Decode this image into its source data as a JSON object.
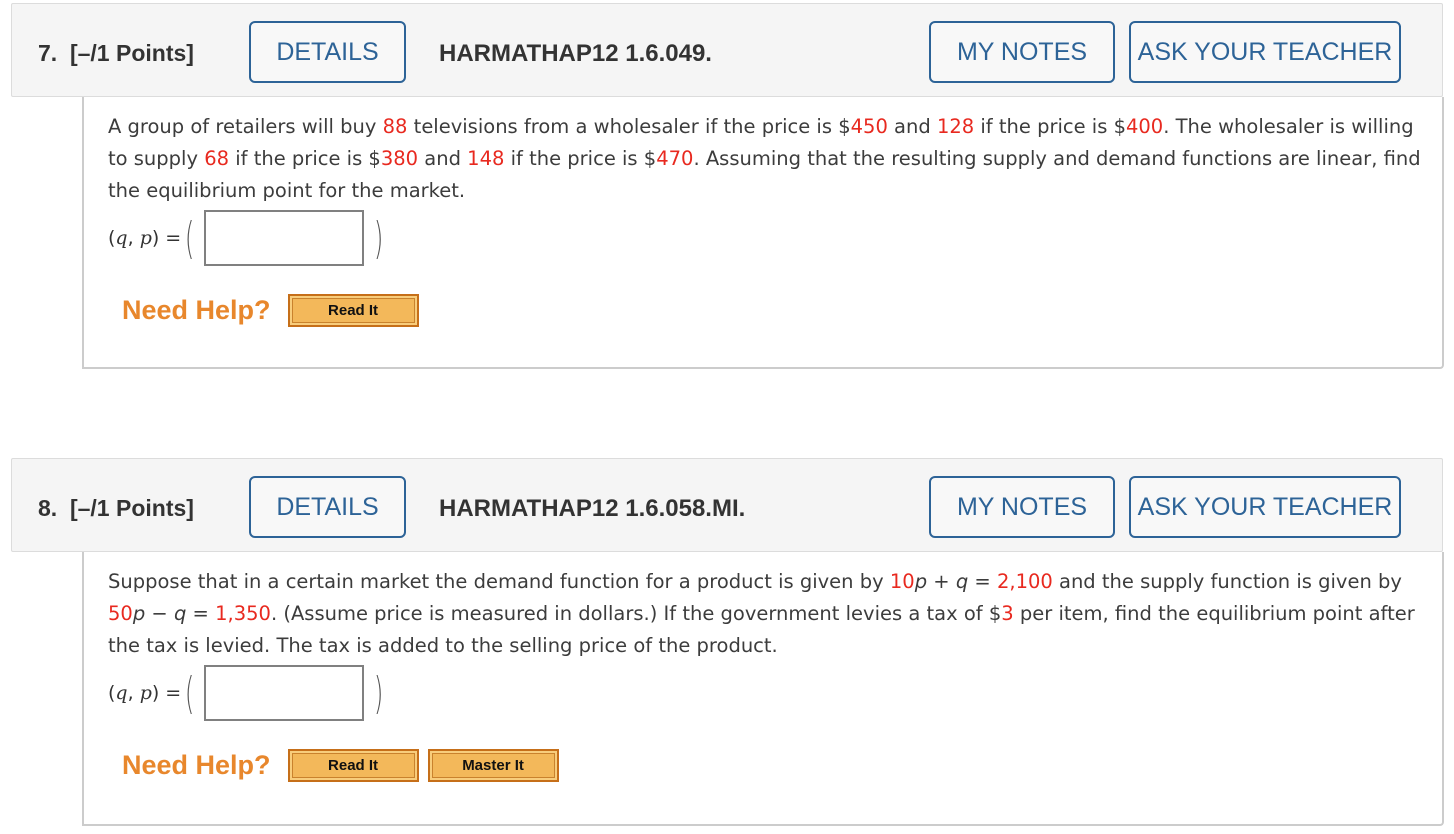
{
  "questions": [
    {
      "number_label": "7.  [–/1 Points]",
      "details_label": "DETAILS",
      "code": "HARMATHAP12 1.6.049.",
      "my_notes_label": "MY NOTES",
      "ask_teacher_label": "ASK YOUR TEACHER",
      "text": {
        "s1": "A group of retailers will buy ",
        "v1": "88",
        "s2": " televisions from a wholesaler if the price is $",
        "v2": "450",
        "s3": " and ",
        "v3": "128",
        "s4": " if the price is $",
        "v4": "400",
        "s5": ". The wholesaler is willing to supply ",
        "v5": "68",
        "s6": " if the price is $",
        "v6": "380",
        "s7": " and ",
        "v7": "148",
        "s8": " if the price is $",
        "v8": "470",
        "s9": ". Assuming that the resulting supply and demand functions are linear, find the equilibrium point for the market."
      },
      "answer_label_prefix": "(",
      "answer_var_q": "q",
      "answer_sep": ", ",
      "answer_var_p": "p",
      "answer_label_suffix": ") =",
      "answer_value": "",
      "need_help_label": "Need Help?",
      "help_buttons": [
        "Read It"
      ]
    },
    {
      "number_label": "8.  [–/1 Points]",
      "details_label": "DETAILS",
      "code": "HARMATHAP12 1.6.058.MI.",
      "my_notes_label": "MY NOTES",
      "ask_teacher_label": "ASK YOUR TEACHER",
      "text": {
        "s1": "Suppose that in a certain market the demand function for a product is given by ",
        "v1": "10",
        "s2a": "p",
        "s2b": " + ",
        "s2c": "q",
        "s2d": " = ",
        "v2": "2,100",
        "s3": " and the supply function is given by ",
        "v3": "50",
        "s4a": "p",
        "s4b": " − ",
        "s4c": "q",
        "s4d": " = ",
        "v4": "1,350",
        "s5": ". (Assume price is measured in dollars.) If the government levies a tax of $",
        "v5": "3",
        "s6": " per item, find the equilibrium point after the tax is levied. The tax is added to the selling price of the product."
      },
      "answer_label_prefix": "(",
      "answer_var_q": "q",
      "answer_sep": ", ",
      "answer_var_p": "p",
      "answer_label_suffix": ") =",
      "answer_value": "",
      "need_help_label": "Need Help?",
      "help_buttons": [
        "Read It",
        "Master It"
      ]
    }
  ],
  "colors": {
    "accent_blue": "#2d6397",
    "value_red": "#e8291f",
    "need_help_orange": "#e8872c",
    "help_button_fill": "#f3b85a"
  }
}
